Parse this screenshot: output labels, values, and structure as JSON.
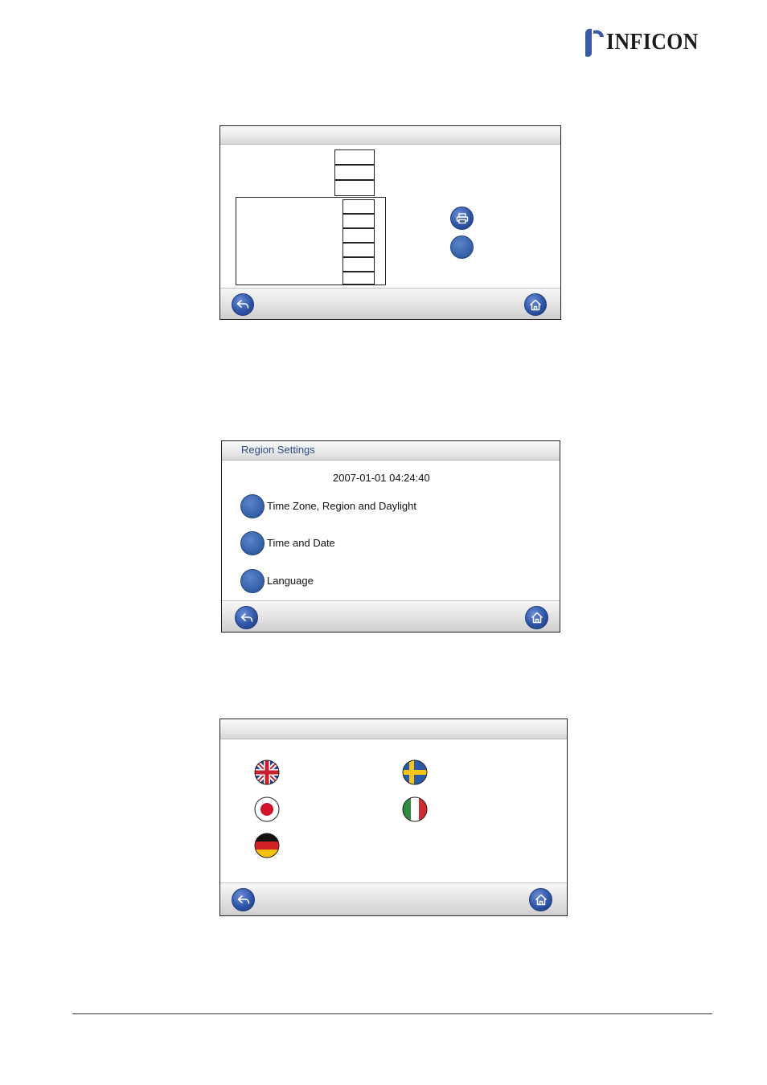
{
  "brand": {
    "name": "INFICON"
  },
  "screen1": {
    "buttons": {
      "back_icon": "back-arrow-icon",
      "home_icon": "home-icon",
      "print_icon": "printer-icon"
    }
  },
  "screen2": {
    "title": "Region Settings",
    "datetime": "2007-01-01 04:24:40",
    "options": [
      {
        "label": "Time Zone, Region and Daylight"
      },
      {
        "label": "Time and Date"
      },
      {
        "label": "Language"
      }
    ]
  },
  "screen3": {
    "flags": [
      "uk-flag-icon",
      "sweden-flag-icon",
      "japan-flag-icon",
      "italy-flag-icon",
      "germany-flag-icon"
    ]
  },
  "colors": {
    "accent": "#2f55a8",
    "title_text": "#2b4b88"
  }
}
